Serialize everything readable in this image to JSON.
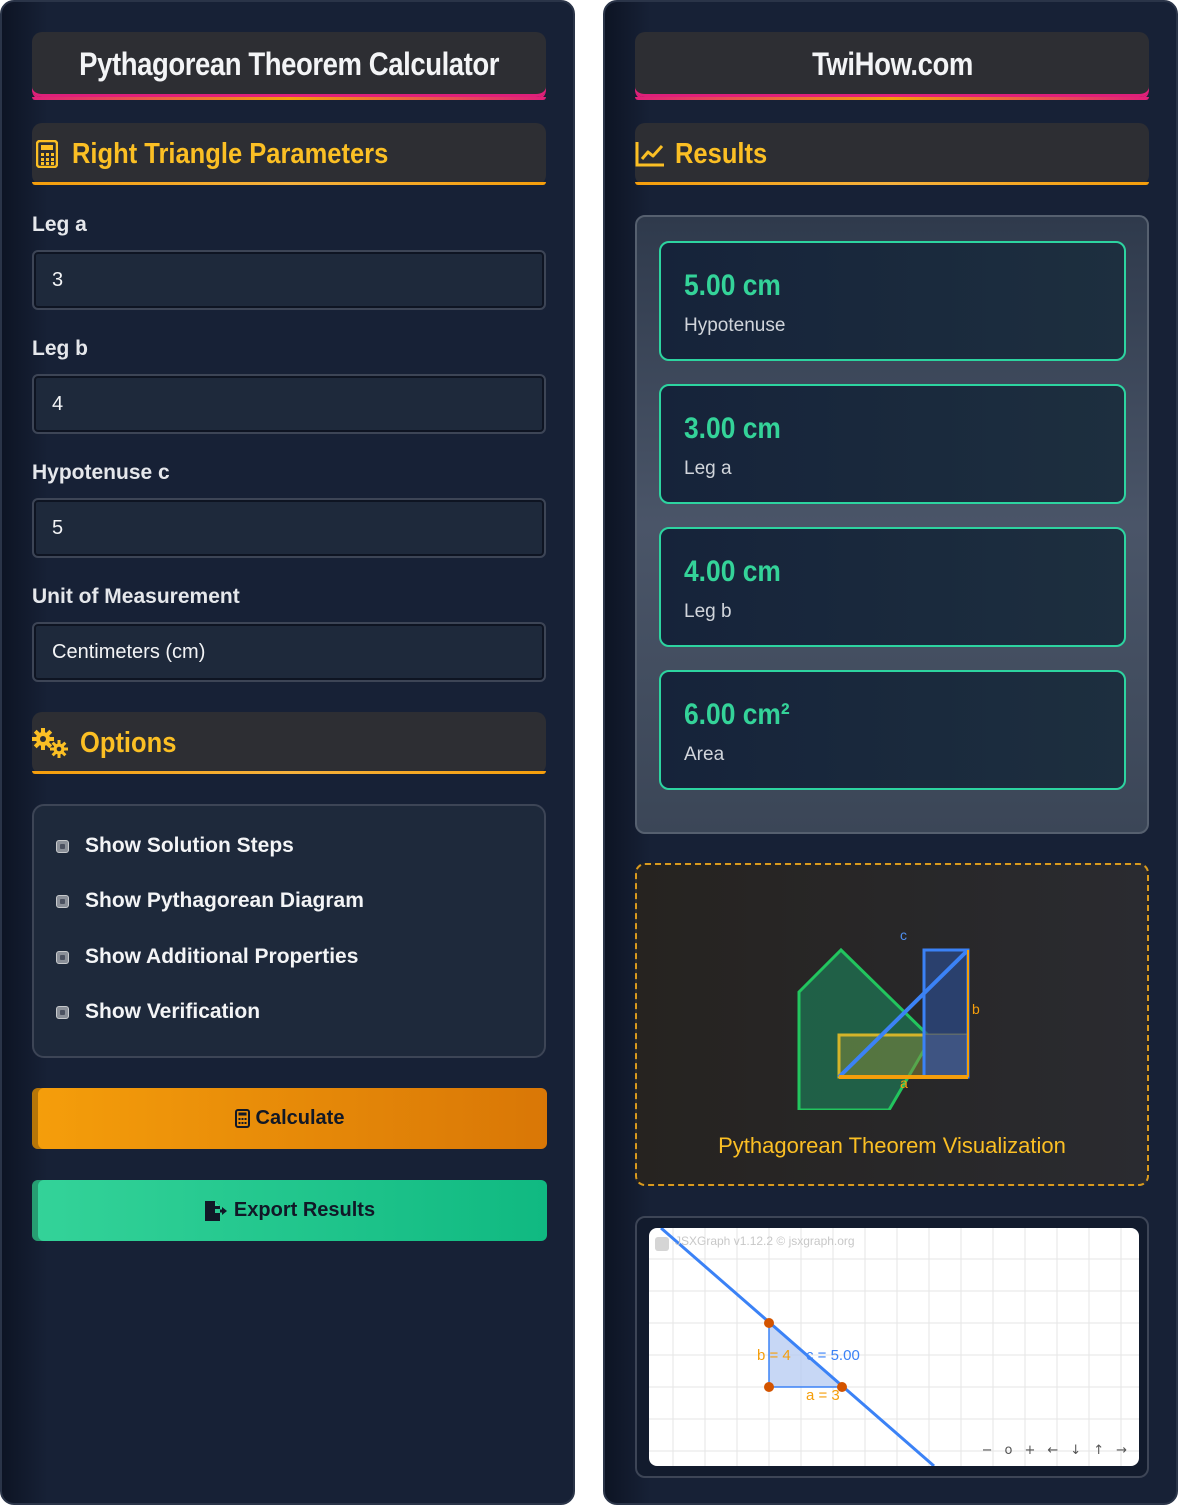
{
  "left": {
    "title": "Pythagorean Theorem Calculator",
    "params_section": {
      "title": "Right Triangle Parameters",
      "icon": "calculator-icon"
    },
    "fields": [
      {
        "label": "Leg a",
        "value": "3"
      },
      {
        "label": "Leg b",
        "value": "4"
      },
      {
        "label": "Hypotenuse c",
        "value": "5"
      }
    ],
    "unit": {
      "label": "Unit of Measurement",
      "value": "Centimeters (cm)"
    },
    "options_section": {
      "title": "Options",
      "icon": "gears-icon"
    },
    "options": [
      "Show Solution Steps",
      "Show Pythagorean Diagram",
      "Show Additional Properties",
      "Show Verification"
    ],
    "calculate_label": "Calculate",
    "export_label": "Export Results"
  },
  "right": {
    "title": "TwiHow.com",
    "results_section": {
      "title": "Results",
      "icon": "chart-line-icon"
    },
    "results": [
      {
        "value": "5.00 cm",
        "label": "Hypotenuse"
      },
      {
        "value": "3.00 cm",
        "label": "Leg a"
      },
      {
        "value": "4.00 cm",
        "label": "Leg b"
      },
      {
        "value": "6.00 cm²",
        "label": "Area"
      }
    ],
    "visualization": {
      "caption": "Pythagorean Theorem Visualization",
      "label_a": "a",
      "label_b": "b",
      "label_c": "c"
    },
    "graph": {
      "credit": "JSXGraph v1.12.2 © jsxgraph.org",
      "label_b": "b = 4",
      "label_c": "c = 5.00",
      "label_a": "a = 3",
      "nav": [
        "−",
        "o",
        "+",
        "←",
        "↓",
        "↑",
        "→"
      ]
    }
  },
  "colors": {
    "accent_orange": "#f59e0b",
    "accent_green": "#34d399",
    "accent_pink": "#e0207a",
    "panel_bg": "#172136"
  }
}
